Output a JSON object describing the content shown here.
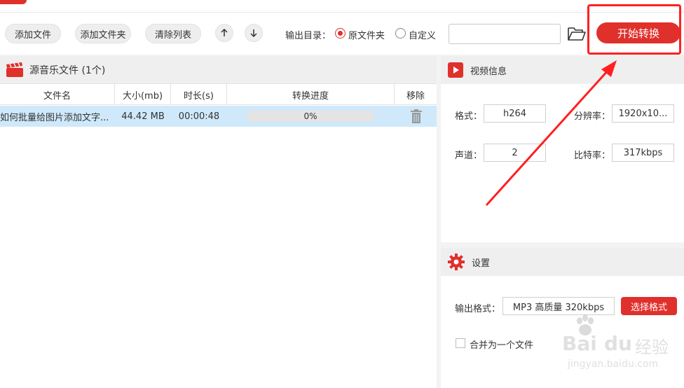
{
  "toolbar": {
    "add_file": "添加文件",
    "add_folder": "添加文件夹",
    "clear_list": "清除列表",
    "output_dir_label": "输出目录：",
    "radio_original": "原文件夹",
    "radio_custom": "自定义",
    "path_value": "",
    "start_label": "开始转换"
  },
  "source": {
    "title": "源音乐文件 (1个)",
    "columns": [
      "文件名",
      "大小(mb)",
      "时长(s)",
      "转换进度",
      "移除"
    ],
    "rows": [
      {
        "name": "如何批量给图片添加文字...",
        "size": "44.42 MB",
        "duration": "00:00:48",
        "progress": "0%",
        "progress_value": 0
      }
    ]
  },
  "video_info": {
    "title": "视频信息",
    "format_label": "格式：",
    "format_value": "h264",
    "resolution_label": "分辨率：",
    "resolution_value": "1920x10...",
    "channel_label": "声道：",
    "channel_value": "2",
    "bitrate_label": "比特率：",
    "bitrate_value": "317kbps"
  },
  "settings": {
    "title": "设置",
    "output_format_label": "输出格式：",
    "output_format_value": "MP3 高质量 320kbps",
    "select_format_label": "选择格式",
    "merge_label": "合并为一个文件"
  },
  "watermark": {
    "brand": "Bai",
    "brand2": "du",
    "cn": "经验",
    "url": "jingyan.baidu.com"
  },
  "colors": {
    "accent": "#e0302c",
    "annotation": "#ff2020",
    "row_selected": "#cfe9fb"
  }
}
